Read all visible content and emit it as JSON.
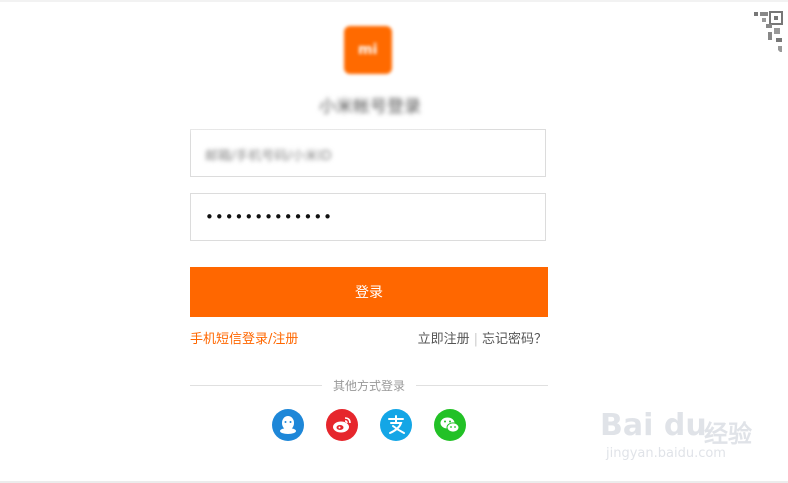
{
  "brand": {
    "logo_text": "mi",
    "title": "小米帐号登录",
    "accent_color": "#ff6700"
  },
  "form": {
    "account_value": "邮箱/手机号码/小米ID",
    "password_masked": "•••••••••••••",
    "login_label": "登录"
  },
  "links": {
    "sms_login": "手机短信登录/注册",
    "register": "立即注册",
    "separator": "|",
    "forgot": "忘记密码？"
  },
  "other_methods": {
    "label": "其他方式登录",
    "providers": [
      {
        "name": "qq",
        "color": "#1e87d8"
      },
      {
        "name": "weibo",
        "color": "#e6262c"
      },
      {
        "name": "alipay",
        "color": "#14a6e6"
      },
      {
        "name": "wechat",
        "color": "#22c126"
      }
    ]
  },
  "watermark": {
    "brand": "Bai  du",
    "label": "经验",
    "url": "jingyan.baidu.com"
  }
}
